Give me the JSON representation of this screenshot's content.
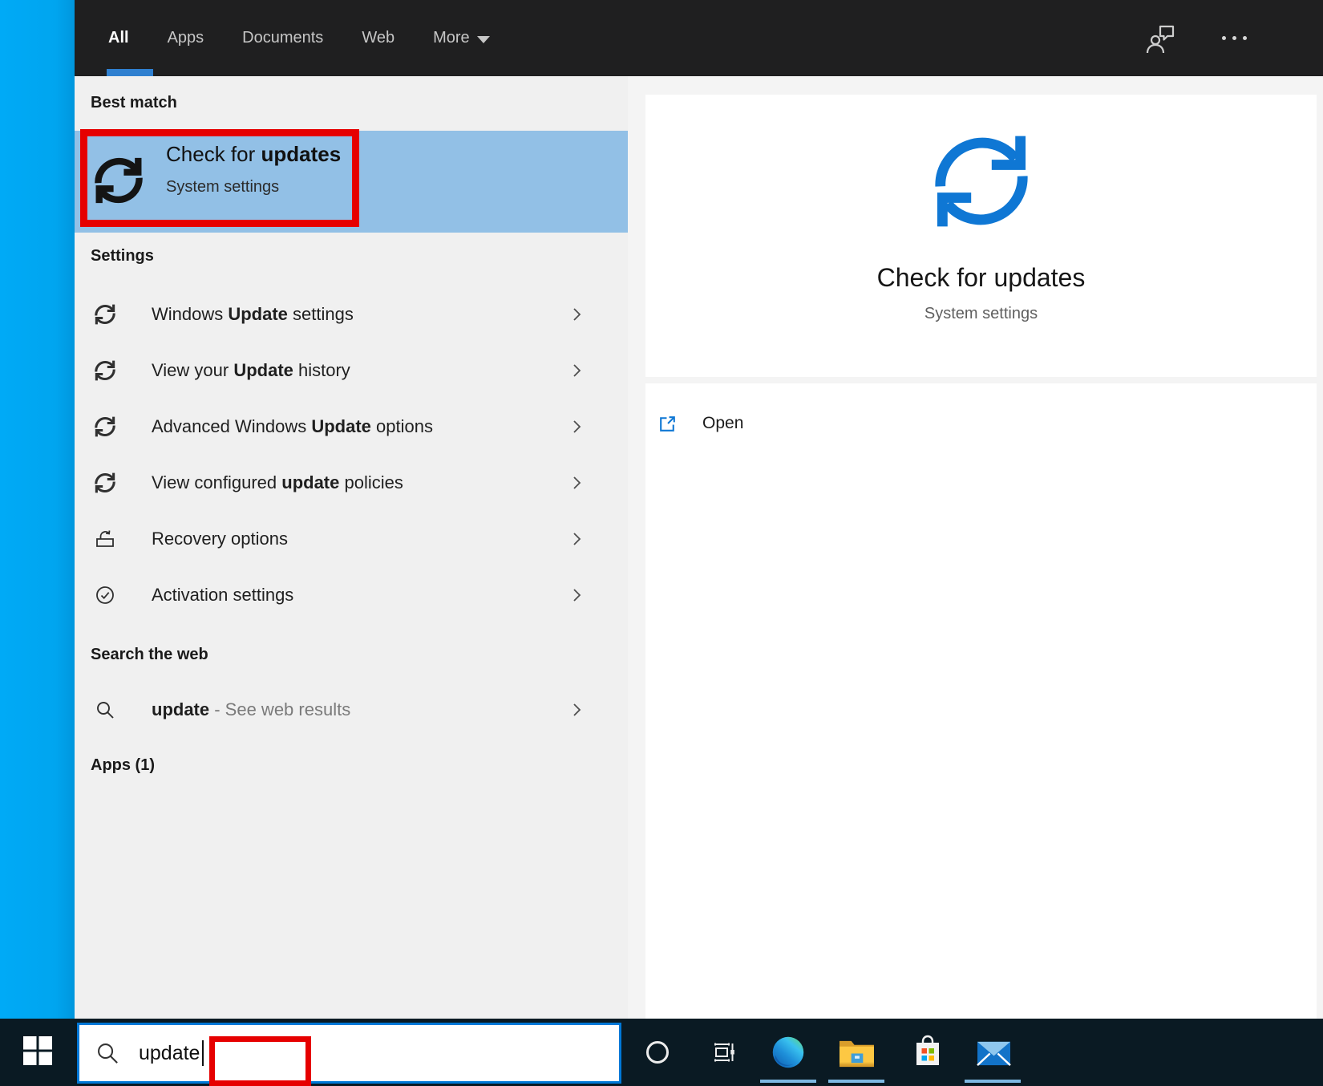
{
  "colors": {
    "accent": "#0078d7",
    "strip": "#00a8f4",
    "header": "#1f1f20",
    "taskbar": "#0a1a23",
    "panel": "#f0f0f0",
    "panel2": "#f4f4f4",
    "highlight": "#92c0e6",
    "red": "#e60000",
    "iconblue": "#0f77d4",
    "underline": "#7db8e2"
  },
  "header": {
    "tabs": [
      {
        "label": "All",
        "active": true
      },
      {
        "label": "Apps",
        "active": false
      },
      {
        "label": "Documents",
        "active": false
      },
      {
        "label": "Web",
        "active": false
      },
      {
        "label": "More",
        "active": false
      }
    ],
    "icons": [
      "feedback-icon",
      "ellipsis-icon"
    ]
  },
  "search_panel": {
    "best_match": {
      "label": "Best match",
      "title_pre": "Check for ",
      "title_bold": "updates",
      "subtitle": "System settings",
      "icon": "sync-icon"
    },
    "settings": {
      "label": "Settings",
      "items": [
        {
          "pre": "Windows ",
          "bold": "Update",
          "post": " settings",
          "icon": "sync-icon"
        },
        {
          "pre": "View your ",
          "bold": "Update",
          "post": " history",
          "icon": "sync-icon"
        },
        {
          "pre": "Advanced Windows ",
          "bold": "Update",
          "post": " options",
          "icon": "sync-icon"
        },
        {
          "pre": "View configured ",
          "bold": "update",
          "post": " policies",
          "icon": "sync-icon"
        },
        {
          "pre": "Recovery options",
          "bold": "",
          "post": "",
          "icon": "recovery-icon"
        },
        {
          "pre": "Activation settings",
          "bold": "",
          "post": "",
          "icon": "activation-icon"
        }
      ]
    },
    "web": {
      "label": "Search the web",
      "query": "update ",
      "suffix": "- See web results",
      "icon": "search-icon"
    },
    "apps": {
      "label": "Apps (1)"
    }
  },
  "preview": {
    "icon": "sync-icon",
    "title": "Check for updates",
    "subtitle": "System settings",
    "open_label": "Open",
    "open_icon": "open-external-icon"
  },
  "taskbar": {
    "start": "windows-logo",
    "search_value": "update",
    "icons": [
      "cortana-icon",
      "task-view-icon",
      "edge-icon",
      "file-explorer-icon",
      "store-icon",
      "mail-icon"
    ],
    "running_indicators": [
      "edge-icon",
      "file-explorer-icon",
      "mail-icon"
    ]
  }
}
